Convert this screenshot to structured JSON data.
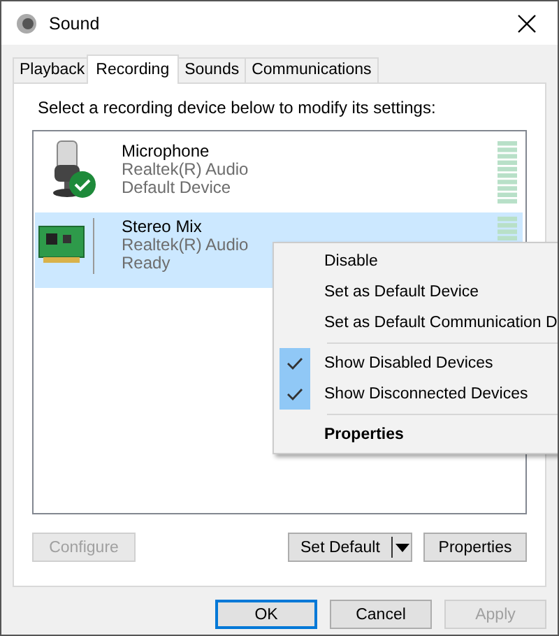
{
  "window": {
    "title": "Sound"
  },
  "tabs": [
    {
      "label": "Playback",
      "selected": false
    },
    {
      "label": "Recording",
      "selected": true
    },
    {
      "label": "Sounds",
      "selected": false
    },
    {
      "label": "Communications",
      "selected": false
    }
  ],
  "instruction": "Select a recording device below to modify its settings:",
  "devices": [
    {
      "kind": "microphone",
      "name": "Microphone",
      "driver": "Realtek(R) Audio",
      "status": "Default Device",
      "default": true,
      "selected": false
    },
    {
      "kind": "sound-card",
      "name": "Stereo Mix",
      "driver": "Realtek(R) Audio",
      "status": "Ready",
      "default": false,
      "selected": true
    }
  ],
  "context_menu": [
    {
      "kind": "item",
      "label": "Disable",
      "checked": false,
      "bold": false
    },
    {
      "kind": "item",
      "label": "Set as Default Device",
      "checked": false,
      "bold": false
    },
    {
      "kind": "item",
      "label": "Set as Default Communication D",
      "checked": false,
      "bold": false
    },
    {
      "kind": "separator"
    },
    {
      "kind": "item",
      "label": "Show Disabled Devices",
      "checked": true,
      "bold": false
    },
    {
      "kind": "item",
      "label": "Show Disconnected Devices",
      "checked": true,
      "bold": false
    },
    {
      "kind": "separator"
    },
    {
      "kind": "item",
      "label": "Properties",
      "checked": false,
      "bold": true
    }
  ],
  "panel_buttons": [
    {
      "kind": "button",
      "label": "Configure",
      "disabled": true
    },
    {
      "kind": "split",
      "label": "Set Default",
      "disabled": false
    },
    {
      "kind": "button",
      "label": "Properties",
      "disabled": false
    }
  ],
  "dialog_buttons": [
    {
      "label": "OK",
      "default": true,
      "disabled": false
    },
    {
      "label": "Cancel",
      "default": false,
      "disabled": false
    },
    {
      "label": "Apply",
      "default": false,
      "disabled": true
    }
  ]
}
